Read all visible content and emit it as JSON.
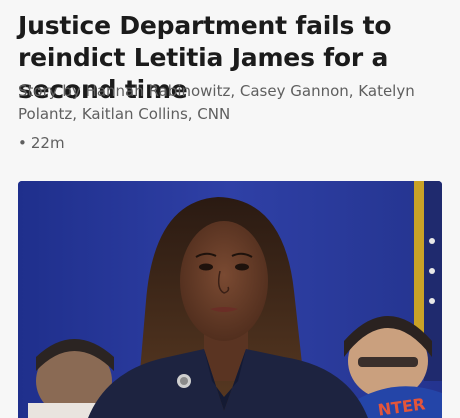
{
  "article": {
    "headline": "Justice Department fails to reindict Letitia James for a second time",
    "byline": "Story by Hannah Rabinowitz, Casey Gannon, Katelyn Polantz, Kaitlan Collins, CNN",
    "timestamp_bullet": "•",
    "timestamp": "22m",
    "image": {
      "background_color": "#2a3a9a",
      "banner_text": "NTER"
    }
  }
}
